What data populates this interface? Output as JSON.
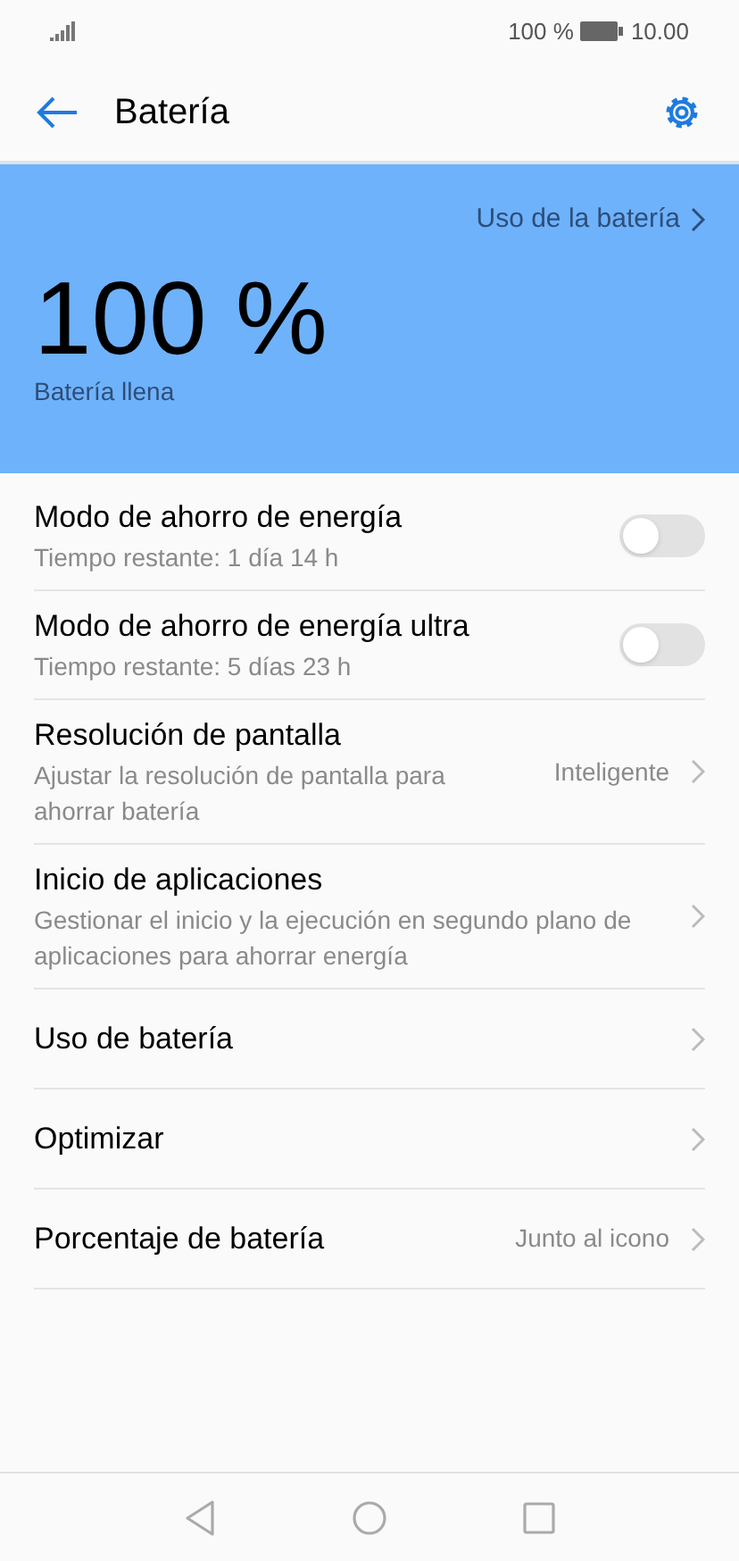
{
  "status_bar": {
    "battery_text": "100 %",
    "time": "10.00"
  },
  "app_bar": {
    "title": "Batería"
  },
  "battery_card": {
    "link": "Uso de la batería",
    "percent": "100 %",
    "status": "Batería llena"
  },
  "settings": [
    {
      "kind": "toggle",
      "title": "Modo de ahorro de energía",
      "subtitle": "Tiempo restante: 1 día 14 h",
      "on": false
    },
    {
      "kind": "toggle",
      "title": "Modo de ahorro de energía ultra",
      "subtitle": "Tiempo restante: 5 días 23 h",
      "on": false
    },
    {
      "kind": "link",
      "title": "Resolución de pantalla",
      "subtitle": "Ajustar la resolución de pantalla para ahorrar batería",
      "value": "Inteligente"
    },
    {
      "kind": "link",
      "title": "Inicio de aplicaciones",
      "subtitle": "Gestionar el inicio y la ejecución en segundo plano de aplicaciones para ahorrar energía"
    },
    {
      "kind": "link",
      "title": "Uso de batería"
    },
    {
      "kind": "link",
      "title": "Optimizar"
    },
    {
      "kind": "link",
      "title": "Porcentaje de batería",
      "value": "Junto al icono"
    }
  ]
}
